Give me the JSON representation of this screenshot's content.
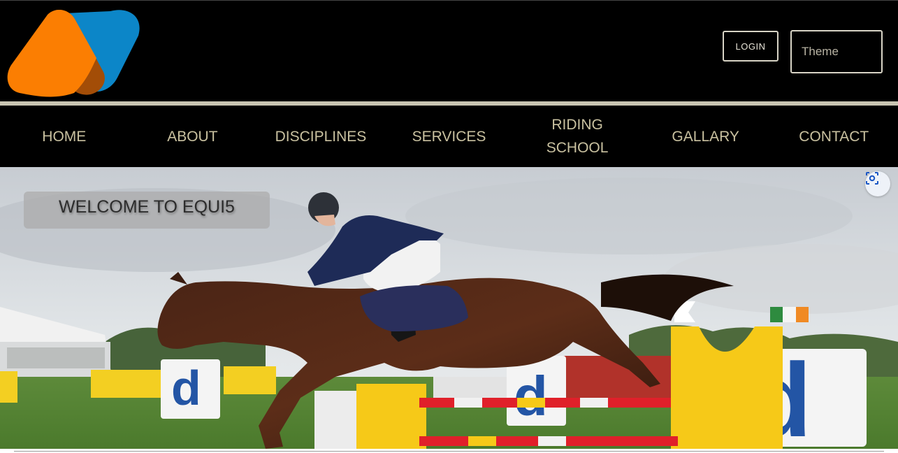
{
  "header": {
    "logo": {
      "name": "logo-mark",
      "colors": {
        "orange": "#fb7e02",
        "brown": "#a34d07",
        "blue": "#0c86c8"
      }
    },
    "login_label": "LOGIN",
    "theme_select": {
      "value": "Theme"
    }
  },
  "nav": {
    "items": [
      {
        "label": "HOME"
      },
      {
        "label": "ABOUT"
      },
      {
        "label": "DISCIPLINES"
      },
      {
        "label": "SERVICES"
      },
      {
        "label": "RIDING SCHOOL"
      },
      {
        "label": "GALLARY"
      },
      {
        "label": "CONTACT"
      }
    ],
    "text_color": "#c9c1a0"
  },
  "hero": {
    "welcome": "WELCOME TO EQUI5",
    "image_subject": "show jumping horse and rider clearing a fence",
    "lens_icon": "visual-search-icon"
  },
  "colors": {
    "header_bg": "#000000",
    "divider": "#c9c5b2"
  }
}
